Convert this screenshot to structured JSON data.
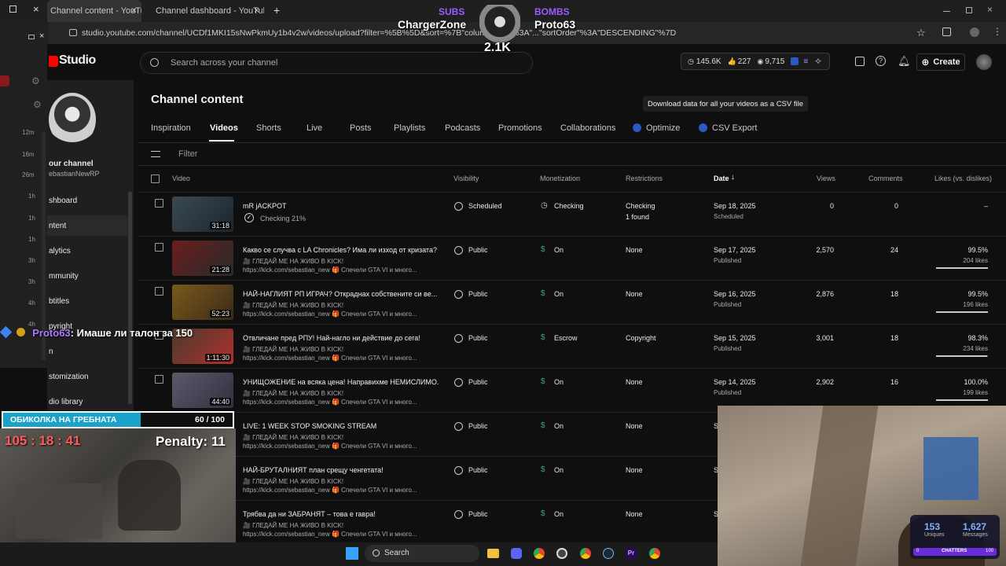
{
  "browser": {
    "tabs": [
      {
        "title": "Channel content - YouTube Stu"
      },
      {
        "title": "Channel dashboard - YouTube"
      }
    ],
    "new_tab": "+",
    "url": "studio.youtube.com/channel/UCDf1MKI15sNwPkmUy1b4v2w/videos/upload?filter=%5B%5D&sort=%7B\"columnType\"%3A\"...\"sortOrder\"%3A\"DESCENDING\"%7D"
  },
  "left_panel": {
    "times": [
      "12m",
      "16m",
      "26m",
      "1h",
      "1h",
      "1h",
      "3h",
      "3h",
      "4h",
      "4h"
    ]
  },
  "header": {
    "logo_text": "Studio",
    "search_placeholder": "Search across your channel",
    "stats": {
      "views": "145.6K",
      "likes": "227",
      "subs": "9,715"
    },
    "create_label": "Create"
  },
  "sidebar": {
    "channel_label": "our channel",
    "channel_handle": "ebastianNewRP",
    "items": [
      "shboard",
      "ntent",
      "alytics",
      "mmunity",
      "btitles",
      "pyright",
      "n",
      "stomization",
      "dio library"
    ]
  },
  "main": {
    "title": "Channel content",
    "tabs": [
      "Inspiration",
      "Videos",
      "Shorts",
      "Live",
      "Posts",
      "Playlists",
      "Podcasts",
      "Promotions",
      "Collaborations",
      "Optimize",
      "CSV Export"
    ],
    "filter_placeholder": "Filter",
    "tooltip": "Download data for all your videos as a CSV file",
    "columns": {
      "video": "Video",
      "visibility": "Visibility",
      "monetization": "Monetization",
      "restrictions": "Restrictions",
      "date": "Date",
      "views": "Views",
      "comments": "Comments",
      "likes": "Likes (vs. dislikes)"
    },
    "rows": [
      {
        "title": "mR jACKPOT",
        "desc1": "Checking 21%",
        "desc2": "",
        "duration": "31:18",
        "visibility": "Scheduled",
        "monetization": "Checking",
        "restrictions": "Checking",
        "restrictions2": "1 found",
        "date": "Sep 18, 2025",
        "status": "Scheduled",
        "views": "0",
        "comments": "0",
        "likes": "–",
        "likes_count": "",
        "likes_fraction": 0
      },
      {
        "title": "Какво се случва с LA Chronicles? Има ли изход от кризата?",
        "desc1": "🎥 ГЛЕДАЙ МЕ НА ЖИВО В KICK!",
        "desc2": "https://kick.com/sebastian_new 🎁 Спечели GTA VI и много...",
        "duration": "21:28",
        "visibility": "Public",
        "monetization": "On",
        "restrictions": "None",
        "restrictions2": "",
        "date": "Sep 17, 2025",
        "status": "Published",
        "views": "2,570",
        "comments": "24",
        "likes": "99.5%",
        "likes_count": "204 likes",
        "likes_fraction": 0.995
      },
      {
        "title": "НАЙ-НАГЛИЯТ РП ИГРАЧ? Откраднах собствените си ве...",
        "desc1": "🎥 ГЛЕДАЙ МЕ НА ЖИВО В KICK!",
        "desc2": "https://kick.com/sebastian_new 🎁 Спечели GTA VI и много...",
        "duration": "52:23",
        "visibility": "Public",
        "monetization": "On",
        "restrictions": "None",
        "restrictions2": "",
        "date": "Sep 16, 2025",
        "status": "Published",
        "views": "2,876",
        "comments": "18",
        "likes": "99.5%",
        "likes_count": "196 likes",
        "likes_fraction": 0.995
      },
      {
        "title": "Отвличане пред РПУ! Най-нагло ни действие до сега!",
        "desc1": "🎥 ГЛЕДАЙ МЕ НА ЖИВО В KICK!",
        "desc2": "https://kick.com/sebastian_new 🎁 Спечели GTA VI и много...",
        "duration": "1:11:30",
        "visibility": "Public",
        "monetization": "Escrow",
        "restrictions": "Copyright",
        "restrictions2": "",
        "date": "Sep 15, 2025",
        "status": "Published",
        "views": "3,001",
        "comments": "18",
        "likes": "98.3%",
        "likes_count": "234 likes",
        "likes_fraction": 0.983
      },
      {
        "title": "УНИЩОЖЕНИЕ на всяка цена! Направихме НЕМИСЛИМО...",
        "desc1": "🎥 ГЛЕДАЙ МЕ НА ЖИВО В KICK!",
        "desc2": "https://kick.com/sebastian_new 🎁 Спечели GTA VI и много...",
        "duration": "44:40",
        "visibility": "Public",
        "monetization": "On",
        "restrictions": "None",
        "restrictions2": "",
        "date": "Sep 14, 2025",
        "status": "Published",
        "views": "2,902",
        "comments": "16",
        "likes": "100.0%",
        "likes_count": "199 likes",
        "likes_fraction": 1.0
      },
      {
        "title": "LIVE: 1 WEEK STOP SMOKING STREAM",
        "desc1": "🎥 ГЛЕДАЙ МЕ НА ЖИВО В KICK!",
        "desc2": "https://kick.com/sebastian_new 🎁 Спечели GTA VI и много...",
        "duration": "",
        "visibility": "Public",
        "monetization": "On",
        "restrictions": "None",
        "restrictions2": "",
        "date": "S",
        "status": "",
        "views": "",
        "comments": "",
        "likes": "",
        "likes_count": "",
        "likes_fraction": 0
      },
      {
        "title": "НАЙ-БРУТАЛНИЯТ план срещу ченгетата!",
        "desc1": "🎥 ГЛЕДАЙ МЕ НА ЖИВО В KICK!",
        "desc2": "https://kick.com/sebastian_new 🎁 Спечели GTA VI и много...",
        "duration": "",
        "visibility": "Public",
        "monetization": "On",
        "restrictions": "None",
        "restrictions2": "",
        "date": "S",
        "status": "",
        "views": "",
        "comments": "",
        "likes": "",
        "likes_count": "",
        "likes_fraction": 0
      },
      {
        "title": "Трябва да ни ЗАБРАНЯТ – това е гавра!",
        "desc1": "🎥 ГЛЕДАЙ МЕ НА ЖИВО В KICK!",
        "desc2": "https://kick.com/sebastian_new 🎁 Спечели GTA VI и много...",
        "duration": "",
        "visibility": "Public",
        "monetization": "On",
        "restrictions": "None",
        "restrictions2": "",
        "date": "S",
        "status": "",
        "views": "",
        "comments": "",
        "likes": "",
        "likes_count": "",
        "likes_fraction": 0
      }
    ]
  },
  "stream_overlay": {
    "subs_label": "SUBS",
    "subs_name": "ChargerZone",
    "bombs_label": "BOMBS",
    "bombs_name": "Proto63",
    "counter": "2.1K",
    "chat_user": "Proto63",
    "chat_message": ": Имаше ли талон за 150",
    "goal_label": "ОБИКОЛКА НА ГРЕБНАТА",
    "goal_progress": "60 / 100",
    "goal_fraction": 0.6,
    "timer": "105 : 18 : 41",
    "penalty": "Penalty: 11",
    "uniques_value": "153",
    "uniques_label": "Uniques",
    "messages_value": "1,627",
    "messages_label": "Messages",
    "chatters_min": "0",
    "chatters_label": "CHATTERS",
    "chatters_max": "100"
  },
  "taskbar": {
    "search_label": "Search"
  },
  "colors": {
    "accent_red": "#ff0000",
    "subs_purple": "#9b5cff",
    "goal_cyan": "#1aa3c9",
    "timer_red": "#ff5a5a"
  }
}
